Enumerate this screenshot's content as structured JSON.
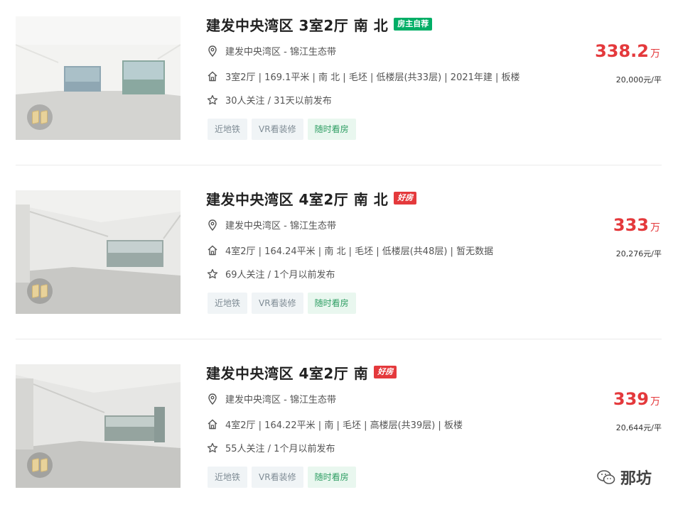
{
  "listings": [
    {
      "title": "建发中央湾区 3室2厅 南 北",
      "tag": "房主自荐",
      "tag_color": "#00ae66",
      "location": "建发中央湾区 - 锦江生态带",
      "house_info": "3室2厅 | 169.1平米 | 南 北 | 毛坯 | 低楼层(共33层) | 2021年建 | 板楼",
      "follow_info": "30人关注 / 31天以前发布",
      "chips": [
        "近地铁",
        "VR看装修",
        "随时看房"
      ],
      "total_price": "338.2",
      "total_unit": "万",
      "unit_price": "20,000元/平"
    },
    {
      "title": "建发中央湾区 4室2厅 南 北",
      "tag": "好房",
      "tag_color": "#e4393c",
      "location": "建发中央湾区 - 锦江生态带",
      "house_info": "4室2厅 | 164.24平米 | 南 北 | 毛坯 | 低楼层(共48层) | 暂无数据",
      "follow_info": "69人关注 / 1个月以前发布",
      "chips": [
        "近地铁",
        "VR看装修",
        "随时看房"
      ],
      "total_price": "333",
      "total_unit": "万",
      "unit_price": "20,276元/平"
    },
    {
      "title": "建发中央湾区 4室2厅 南",
      "tag": "好房",
      "tag_color": "#e4393c",
      "location": "建发中央湾区 - 锦江生态带",
      "house_info": "4室2厅 | 164.22平米 | 南 | 毛坯 | 高楼层(共39层) | 板楼",
      "follow_info": "55人关注 / 1个月以前发布",
      "chips": [
        "近地铁",
        "VR看装修",
        "随时看房"
      ],
      "total_price": "339",
      "total_unit": "万",
      "unit_price": "20,644元/平"
    }
  ],
  "watermark": {
    "text": "那坊",
    "icon": "wechat-icon"
  },
  "colors": {
    "price": "#e4393c",
    "green_tag": "#00ae66",
    "chip_gray_bg": "#f0f4f6",
    "chip_green_bg": "#e9f7ef"
  }
}
